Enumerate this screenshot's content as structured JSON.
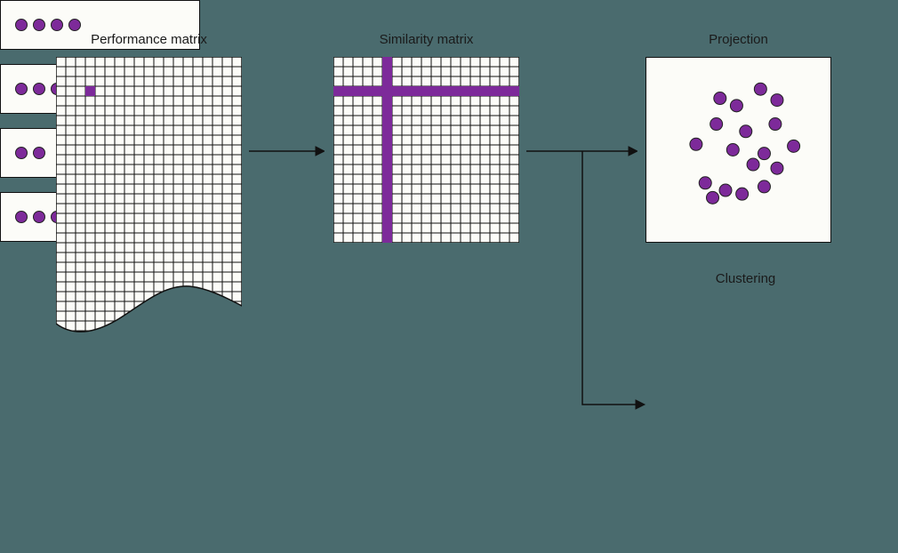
{
  "labels": {
    "performance": "Performance matrix",
    "similarity": "Similarity matrix",
    "projection": "Projection",
    "clustering": "Clustering"
  },
  "colors": {
    "accent": "#7d2a9a",
    "panel_bg": "#fcfcf8",
    "page_bg": "#4a6b6e",
    "stroke": "#111111"
  },
  "performance_matrix": {
    "cols": 19,
    "rows_shown": 28,
    "highlighted_cell": {
      "row": 3,
      "col": 3
    }
  },
  "similarity_matrix": {
    "size": 19,
    "highlighted_row": 3,
    "highlighted_col": 5
  },
  "projection_points": [
    [
      0.4,
      0.22
    ],
    [
      0.49,
      0.26
    ],
    [
      0.62,
      0.17
    ],
    [
      0.71,
      0.23
    ],
    [
      0.38,
      0.36
    ],
    [
      0.54,
      0.4
    ],
    [
      0.7,
      0.36
    ],
    [
      0.27,
      0.47
    ],
    [
      0.47,
      0.5
    ],
    [
      0.64,
      0.52
    ],
    [
      0.8,
      0.48
    ],
    [
      0.58,
      0.58
    ],
    [
      0.71,
      0.6
    ],
    [
      0.32,
      0.68
    ],
    [
      0.43,
      0.72
    ],
    [
      0.52,
      0.74
    ],
    [
      0.64,
      0.7
    ],
    [
      0.36,
      0.76
    ]
  ],
  "clustering_rows": [
    4,
    6,
    2,
    4
  ]
}
